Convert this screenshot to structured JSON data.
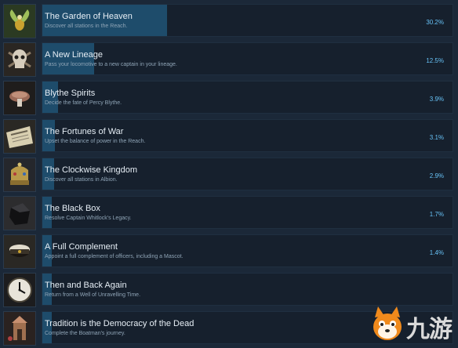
{
  "accent_color": "#1e4c6b",
  "percent_color": "#67c1f5",
  "achievements": [
    {
      "title": "The Garden of Heaven",
      "description": "Discover all stations in the Reach.",
      "percent": "30.2%",
      "fraction": 0.302,
      "icon": "winged-seed-icon"
    },
    {
      "title": "A New Lineage",
      "description": "Pass your locomotive to a new captain in your lineage.",
      "percent": "12.5%",
      "fraction": 0.125,
      "icon": "skull-icon"
    },
    {
      "title": "Blythe Spirits",
      "description": "Decide the fate of Percy Blythe.",
      "percent": "3.9%",
      "fraction": 0.039,
      "icon": "mushroom-icon"
    },
    {
      "title": "The Fortunes of War",
      "description": "Upset the balance of power in the Reach.",
      "percent": "3.1%",
      "fraction": 0.031,
      "icon": "newspaper-icon"
    },
    {
      "title": "The Clockwise Kingdom",
      "description": "Discover all stations in Albion.",
      "percent": "2.9%",
      "fraction": 0.029,
      "icon": "crown-icon"
    },
    {
      "title": "The Black Box",
      "description": "Resolve Captain Whitlock's Legacy.",
      "percent": "1.7%",
      "fraction": 0.017,
      "icon": "black-box-icon"
    },
    {
      "title": "A Full Complement",
      "description": "Appoint a full complement of officers, including a Mascot.",
      "percent": "1.4%",
      "fraction": 0.014,
      "icon": "officer-cap-icon"
    },
    {
      "title": "Then and Back Again",
      "description": "Return from a Well of Unravelling Time.",
      "percent": "",
      "fraction": 0.01,
      "icon": "clock-icon"
    },
    {
      "title": "Tradition is the Democracy of the Dead",
      "description": "Complete the Boatman's journey.",
      "percent": "",
      "fraction": 0.008,
      "icon": "shrine-icon"
    }
  ],
  "watermark": {
    "text": "九游",
    "icon": "fox-mascot-icon"
  }
}
